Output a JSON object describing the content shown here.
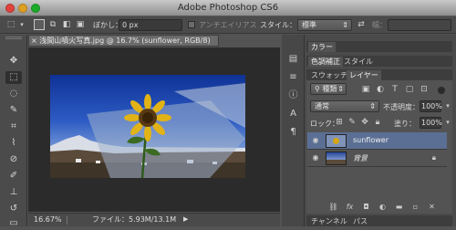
{
  "window": {
    "title": "Adobe Photoshop CS6"
  },
  "options_bar": {
    "feather_label": "ぼかし：",
    "feather_value": "0 px",
    "antialias_label": "アンチエイリアス",
    "style_label": "スタイル：",
    "style_value": "標準",
    "width_label": "幅："
  },
  "document": {
    "tab_title": "浅間山噴火写真.jpg @ 16.7% (sunflower, RGB/8)",
    "close_glyph": "×",
    "zoom": "16.67%",
    "file_info": "ファイル：5.93M/13.1M"
  },
  "panels": {
    "color_tab": "カラー",
    "adjust_tab": "色調補正",
    "style_tab": "スタイル",
    "swatch_tab": "スウォッチ",
    "layers_tab": "レイヤー",
    "filter_kind": "種類",
    "blend_mode": "通常",
    "opacity_label": "不透明度：",
    "opacity_value": "100%",
    "lock_label": "ロック：",
    "fill_label": "塗り：",
    "fill_value": "100%",
    "channels_tab": "チャンネル",
    "paths_tab": "パス"
  },
  "layers": [
    {
      "name": "sunflower",
      "selected": true
    },
    {
      "name": "背景",
      "selected": false,
      "locked": true
    }
  ],
  "colors": {
    "selected_layer": "#5b6f94",
    "chrome": "#4b4b4b"
  }
}
